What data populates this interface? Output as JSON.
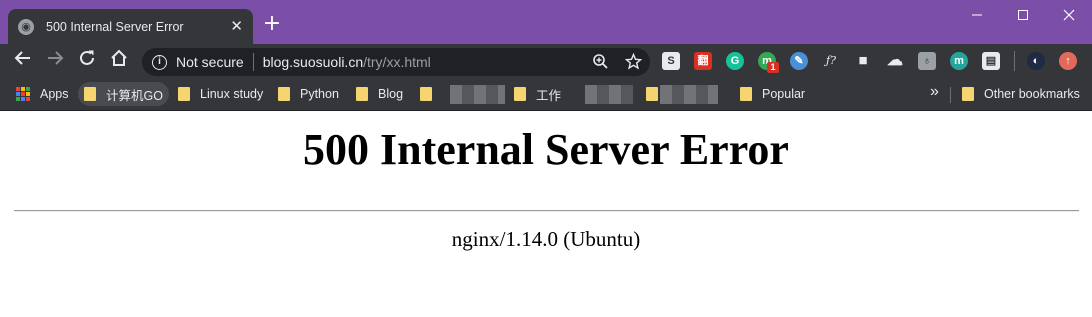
{
  "tab": {
    "title": "500 Internal Server Error",
    "favicon": "globe-icon"
  },
  "window": {
    "minimize": "—",
    "maximize": "☐",
    "close": "✕",
    "titlebar_color": "#7b4ea8"
  },
  "toolbar": {
    "security_label": "Not secure",
    "url_host": "blog.suosuoli.cn",
    "url_path": "/try/xx.html",
    "extensions": [
      {
        "name": "s-extension-icon",
        "glyph": "S",
        "color": "#e8eaed",
        "fg": "#35363a"
      },
      {
        "name": "red-extension-icon",
        "glyph": "翻",
        "color": "#d93025",
        "fg": "#ffffff"
      },
      {
        "name": "grammarly-icon",
        "glyph": "G",
        "color": "#15c39a",
        "fg": "#ffffff"
      },
      {
        "name": "green-extension-icon",
        "glyph": "m",
        "color": "#34a853",
        "fg": "#ffffff",
        "badge": "1"
      },
      {
        "name": "pen-extension-icon",
        "glyph": "✎",
        "color": "#4a90d9",
        "fg": "#ffffff"
      },
      {
        "name": "function-extension-icon",
        "glyph": "ƒ?",
        "color": "transparent",
        "fg": "#e8eaed"
      },
      {
        "name": "cube-extension-icon",
        "glyph": "■",
        "color": "transparent",
        "fg": "#e8eaed"
      },
      {
        "name": "cloud-extension-icon",
        "glyph": "☁",
        "color": "transparent",
        "fg": "#e8eaed"
      },
      {
        "name": "bulb-extension-icon",
        "glyph": "♁",
        "color": "#9aa0a6",
        "fg": "#35363a"
      },
      {
        "name": "m-extension-icon",
        "glyph": "m",
        "color": "#26a69a",
        "fg": "#ffffff"
      },
      {
        "name": "document-extension-icon",
        "glyph": "▤",
        "color": "#e8eaed",
        "fg": "#35363a"
      }
    ]
  },
  "bookmarks": {
    "apps": "Apps",
    "items": [
      "计算机GO",
      "Linux study",
      "Python",
      "Blog"
    ],
    "work": "工作",
    "popular": "Popular",
    "more": "»",
    "other": "Other bookmarks"
  },
  "page": {
    "title": "500 Internal Server Error",
    "server": "nginx/1.14.0 (Ubuntu)"
  }
}
